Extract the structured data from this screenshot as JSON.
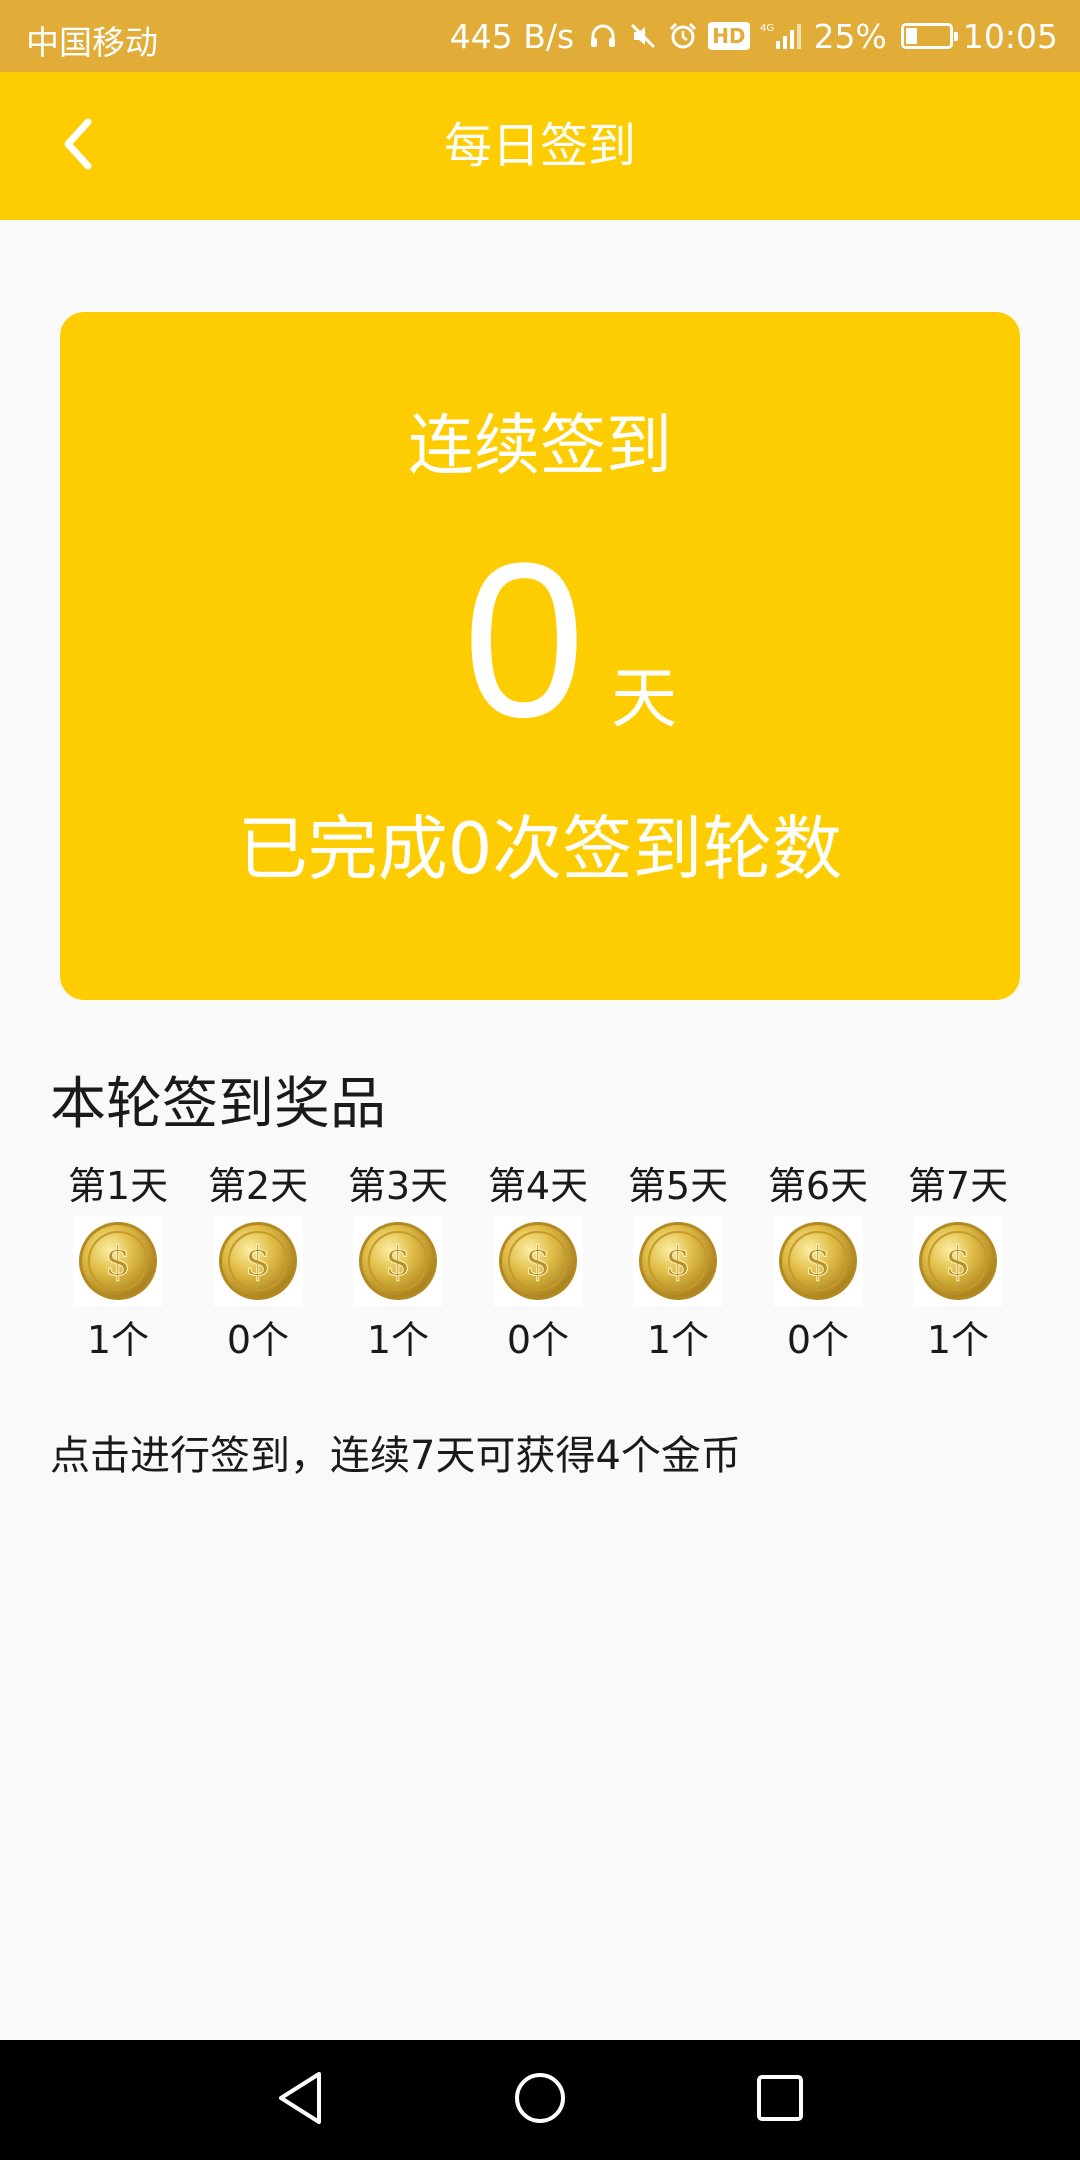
{
  "status_bar": {
    "carrier": "中国移动",
    "net_speed": "445 B/s",
    "network_badge": "HD",
    "battery_percent": "25%",
    "battery_level": 0.25,
    "time": "10:05"
  },
  "header": {
    "title": "每日签到",
    "back_icon": "chevron-left-icon"
  },
  "streak_card": {
    "label": "连续签到",
    "days_count": "0",
    "days_unit": "天",
    "rounds_text": "已完成0次签到轮数"
  },
  "rewards": {
    "title": "本轮签到奖品",
    "days": [
      {
        "label": "第1天",
        "amount": "1个",
        "icon": "gold-coin-icon"
      },
      {
        "label": "第2天",
        "amount": "0个",
        "icon": "gold-coin-icon"
      },
      {
        "label": "第3天",
        "amount": "1个",
        "icon": "gold-coin-icon"
      },
      {
        "label": "第4天",
        "amount": "0个",
        "icon": "gold-coin-icon"
      },
      {
        "label": "第5天",
        "amount": "1个",
        "icon": "gold-coin-icon"
      },
      {
        "label": "第6天",
        "amount": "0个",
        "icon": "gold-coin-icon"
      },
      {
        "label": "第7天",
        "amount": "1个",
        "icon": "gold-coin-icon"
      }
    ],
    "hint": "点击进行签到，连续7天可获得4个金币"
  },
  "colors": {
    "status_bar": "#e1ac37",
    "accent": "#fecd01",
    "background": "#f9f9f9",
    "nav_bar": "#000000"
  },
  "nav_bar": {
    "back_icon": "triangle-back-icon",
    "home_icon": "circle-home-icon",
    "recents_icon": "square-recents-icon"
  }
}
